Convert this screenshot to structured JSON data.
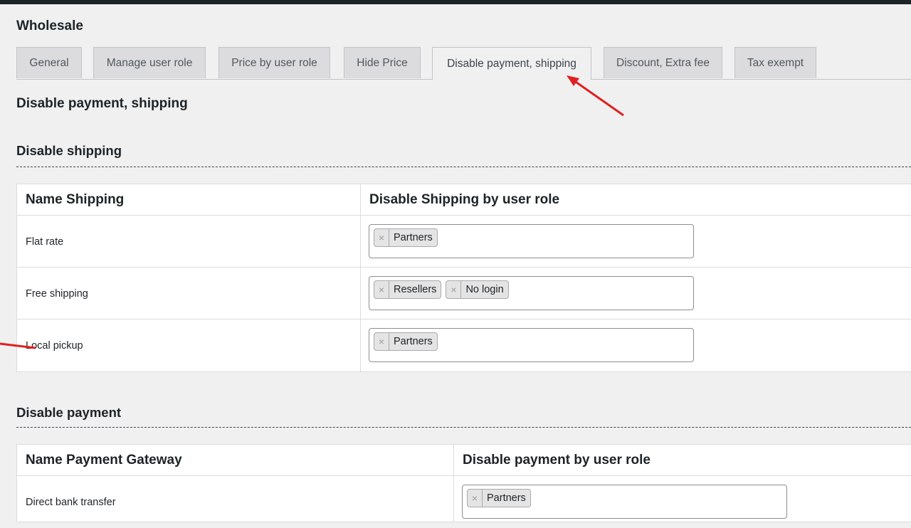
{
  "page": {
    "title": "Wholesale"
  },
  "tabs": [
    {
      "label": "General",
      "active": false
    },
    {
      "label": "Manage user role",
      "active": false
    },
    {
      "label": "Price by user role",
      "active": false
    },
    {
      "label": "Hide Price",
      "active": false
    },
    {
      "label": "Disable payment, shipping",
      "active": true
    },
    {
      "label": "Discount, Extra fee",
      "active": false
    },
    {
      "label": "Tax exempt",
      "active": false
    }
  ],
  "section": {
    "title": "Disable payment, shipping"
  },
  "shipping": {
    "heading": "Disable shipping",
    "col_name": "Name Shipping",
    "col_roles": "Disable Shipping by user role",
    "rows": [
      {
        "name": "Flat rate",
        "roles": [
          "Partners"
        ]
      },
      {
        "name": "Free shipping",
        "roles": [
          "Resellers",
          "No login"
        ]
      },
      {
        "name": "Local pickup",
        "roles": [
          "Partners"
        ]
      }
    ]
  },
  "payment": {
    "heading": "Disable payment",
    "col_name": "Name Payment Gateway",
    "col_roles": "Disable payment by user role",
    "rows": [
      {
        "name": "Direct bank transfer",
        "roles": [
          "Partners"
        ]
      }
    ]
  },
  "icons": {
    "remove": "×"
  },
  "colors": {
    "annotation_arrow": "#e02020",
    "chip_bg": "#e4e4e4",
    "page_bg": "#f0f0f1"
  }
}
